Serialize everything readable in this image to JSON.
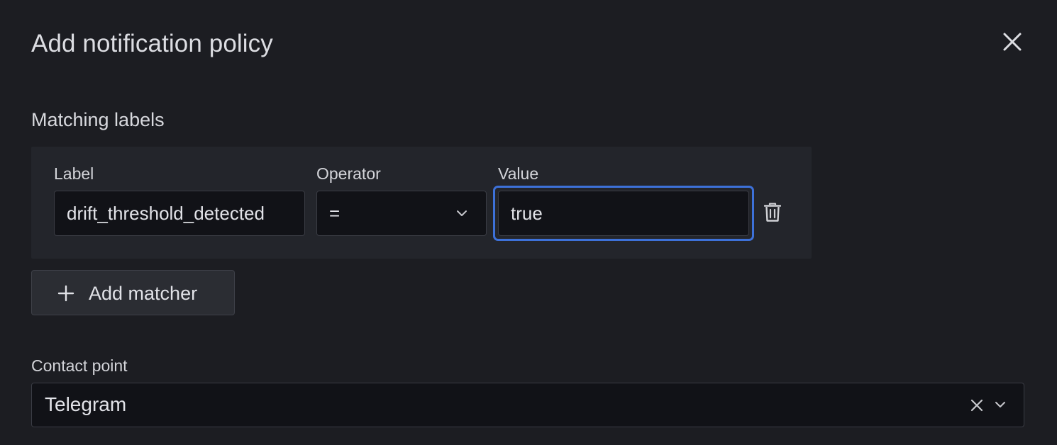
{
  "dialog": {
    "title": "Add notification policy",
    "close_icon": "close-icon"
  },
  "matching_labels": {
    "heading": "Matching labels",
    "matcher": {
      "label_header": "Label",
      "operator_header": "Operator",
      "value_header": "Value",
      "label_value": "drift_threshold_detected",
      "operator_value": "=",
      "value_value": "true",
      "delete_icon": "trash-icon"
    },
    "add_matcher_label": "Add matcher",
    "add_icon": "plus-icon"
  },
  "contact_point": {
    "label": "Contact point",
    "selected": "Telegram",
    "clear_icon": "clear-icon",
    "dropdown_icon": "chevron-down-icon"
  },
  "colors": {
    "background": "#1c1d22",
    "panel": "#23252b",
    "input_bg": "#111217",
    "focus_border": "#3d71d9"
  }
}
